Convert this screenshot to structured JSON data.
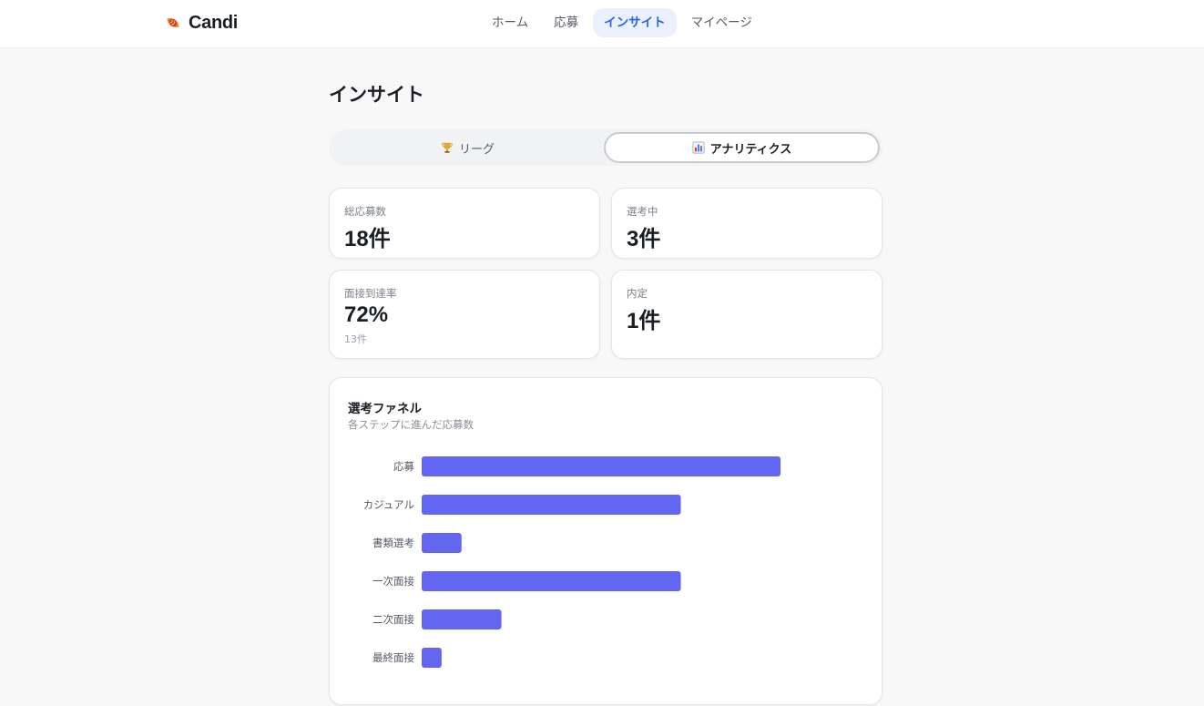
{
  "header": {
    "brand_name": "Candi",
    "brand_icon": "candy-icon",
    "nav": [
      {
        "label": "ホーム",
        "active": false
      },
      {
        "label": "応募",
        "active": false
      },
      {
        "label": "インサイト",
        "active": true
      },
      {
        "label": "マイページ",
        "active": false
      }
    ]
  },
  "page": {
    "title": "インサイト"
  },
  "tabs": [
    {
      "icon": "trophy-icon",
      "label": "リーグ",
      "active": false
    },
    {
      "icon": "bar-chart-icon",
      "label": "アナリティクス",
      "active": true
    }
  ],
  "stats": [
    {
      "label": "総応募数",
      "value": "18件",
      "sub": ""
    },
    {
      "label": "選考中",
      "value": "3件",
      "sub": ""
    },
    {
      "label": "面接到達率",
      "value": "72%",
      "sub": "13件"
    },
    {
      "label": "内定",
      "value": "1件",
      "sub": ""
    }
  ],
  "funnel": {
    "title": "選考ファネル",
    "subtitle": "各ステップに進んだ応募数"
  },
  "colors": {
    "accent": "#2563eb",
    "bar": "#6366f1"
  },
  "chart_data": {
    "type": "bar",
    "orientation": "horizontal",
    "title": "選考ファネル",
    "subtitle": "各ステップに進んだ応募数",
    "categories": [
      "応募",
      "カジュアル",
      "書類選考",
      "一次面接",
      "二次面接",
      "最終面接"
    ],
    "values": [
      18,
      13,
      2,
      13,
      4,
      1
    ],
    "xlim": [
      0,
      18
    ],
    "grid": false,
    "color": "#6366f1"
  }
}
